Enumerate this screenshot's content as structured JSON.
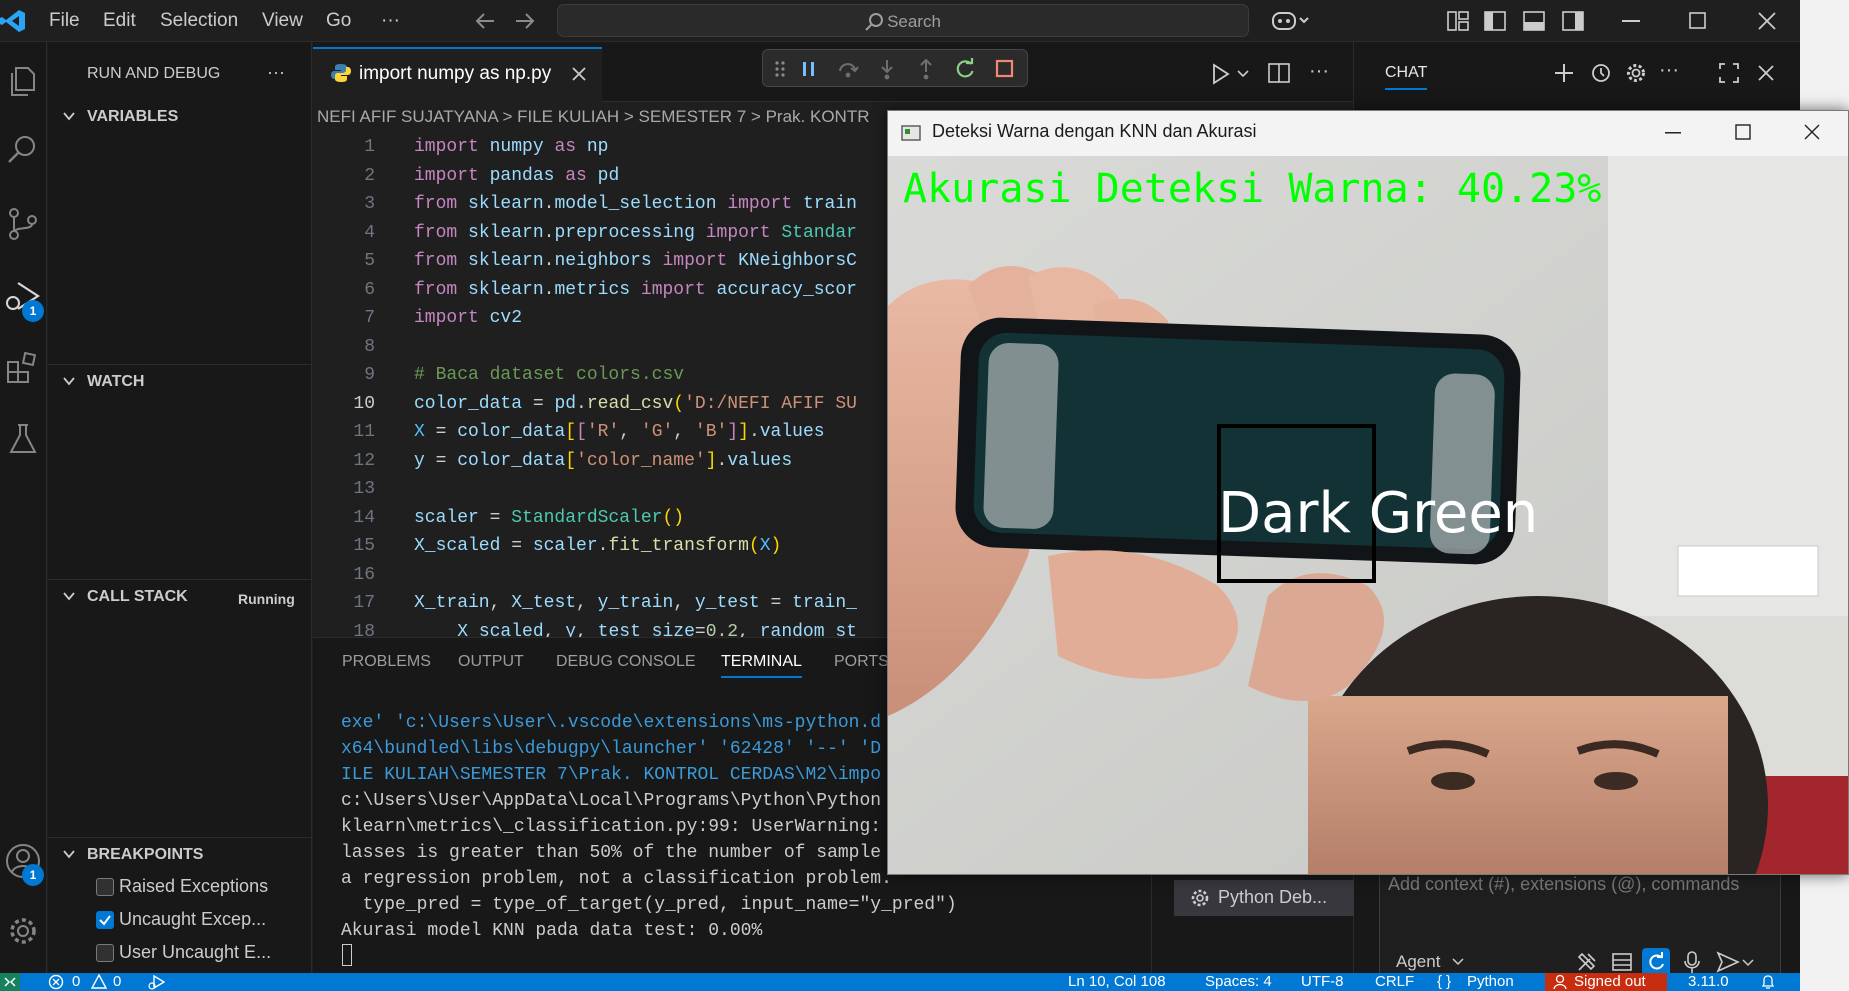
{
  "menu": [
    "File",
    "Edit",
    "Selection",
    "View",
    "Go",
    "···"
  ],
  "search": {
    "label": "Search"
  },
  "sidebar": {
    "title": "RUN AND DEBUG",
    "sections": {
      "variables": "VARIABLES",
      "watch": "WATCH",
      "callstack": "CALL STACK",
      "callstack_status": "Running",
      "breakpoints": "BREAKPOINTS"
    },
    "breakpoints": [
      {
        "label": "Raised Exceptions",
        "checked": false
      },
      {
        "label": "Uncaught Excep...",
        "checked": true
      },
      {
        "label": "User Uncaught E...",
        "checked": false
      }
    ]
  },
  "activity": {
    "debug_badge": "1",
    "account_badge": "1"
  },
  "editor": {
    "tab_label": "import numpy as np.py",
    "breadcrumb": "NEFI AFIF SUJATYANA > FILE KULIAH > SEMESTER 7 > Prak. KONTR",
    "line_numbers": [
      "1",
      "2",
      "3",
      "4",
      "5",
      "6",
      "7",
      "8",
      "9",
      "10",
      "11",
      "12",
      "13",
      "14",
      "15",
      "16",
      "17",
      "18"
    ],
    "code": [
      "import numpy as np",
      "import pandas as pd",
      "from sklearn.model_selection import train",
      "from sklearn.preprocessing import Standar",
      "from sklearn.neighbors import KNeighborsC",
      "from sklearn.metrics import accuracy_scor",
      "import cv2",
      "",
      "# Baca dataset colors.csv",
      "color_data = pd.read_csv('D:/NEFI AFIF SU",
      "X = color_data[['R', 'G', 'B']].values",
      "y = color_data['color_name'].values",
      "",
      "scaler = StandardScaler()",
      "X_scaled = scaler.fit_transform(X)",
      "",
      "X_train, X_test, y_train, y_test = train_",
      "    X_scaled, y, test_size=0.2, random_st"
    ]
  },
  "panel": {
    "tabs": [
      "PROBLEMS",
      "OUTPUT",
      "DEBUG CONSOLE",
      "TERMINAL",
      "PORTS"
    ],
    "terminal_lines": [
      "exe' 'c:\\Users\\User\\.vscode\\extensions\\ms-python.d",
      "x64\\bundled\\libs\\debugpy\\launcher' '62428' '--' 'D",
      "ILE KULIAH\\SEMESTER 7\\Prak. KONTROL CERDAS\\M2\\impo",
      "c:\\Users\\User\\AppData\\Local\\Programs\\Python\\Python",
      "klearn\\metrics\\_classification.py:99: UserWarning:",
      "lasses is greater than 50% of the number of sample",
      "a regression problem, not a classification problem.",
      "  type_pred = type_of_target(y_pred, input_name=\"y_pred\")",
      "Akurasi model KNN pada data test: 0.00%"
    ]
  },
  "chat": {
    "title": "CHAT",
    "input_placeholder": "Add context (#), extensions (@), commands",
    "mode": "Agent",
    "terminal_item": "Python Deb..."
  },
  "cv_window": {
    "title": "Deteksi Warna dengan KNN dan Akurasi",
    "accuracy_text": "Akurasi Deteksi Warna: 40.23%",
    "detected_color": "Dark Green"
  },
  "status": {
    "errors": "0",
    "warnings": "0",
    "position": "Ln 10, Col 108",
    "spaces": "Spaces: 4",
    "encoding": "UTF-8",
    "eol": "CRLF",
    "language": "Python",
    "account": "Signed out",
    "version": "3.11.0"
  },
  "colors": {
    "accent": "#0078d4",
    "status_bar": "#0078d4",
    "cv_text_green": "#00ff00"
  }
}
